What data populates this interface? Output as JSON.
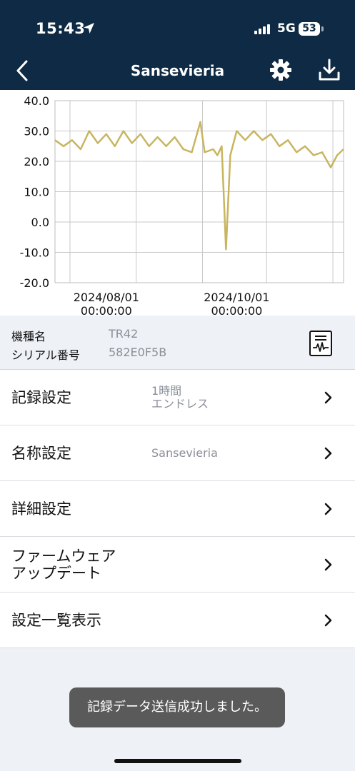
{
  "status": {
    "time": "15:43",
    "network": "5G",
    "battery": "53"
  },
  "nav": {
    "title": "Sansevieria"
  },
  "chart_data": {
    "type": "line",
    "y_ticks": [
      "40.0",
      "30.0",
      "20.0",
      "10.0",
      "0.0",
      "-10.0",
      "-20.0"
    ],
    "ylim": [
      -20,
      40
    ],
    "x_ticks": [
      {
        "date": "2024/08/01",
        "time": "00:00:00"
      },
      {
        "date": "2024/10/01",
        "time": "00:00:00"
      }
    ],
    "x_range": [
      "2024-07-08",
      "2024-11-20"
    ],
    "grid": true,
    "series": [
      {
        "color": "#c8b560",
        "points": [
          [
            "2024-07-08",
            27
          ],
          [
            "2024-07-12",
            25
          ],
          [
            "2024-07-16",
            27
          ],
          [
            "2024-07-20",
            24
          ],
          [
            "2024-07-24",
            30
          ],
          [
            "2024-07-28",
            26
          ],
          [
            "2024-08-01",
            29
          ],
          [
            "2024-08-05",
            25
          ],
          [
            "2024-08-09",
            30
          ],
          [
            "2024-08-13",
            26
          ],
          [
            "2024-08-17",
            29
          ],
          [
            "2024-08-21",
            25
          ],
          [
            "2024-08-25",
            28
          ],
          [
            "2024-08-29",
            25
          ],
          [
            "2024-09-02",
            28
          ],
          [
            "2024-09-06",
            24
          ],
          [
            "2024-09-10",
            23
          ],
          [
            "2024-09-14",
            33
          ],
          [
            "2024-09-16",
            23
          ],
          [
            "2024-09-20",
            24
          ],
          [
            "2024-09-22",
            22
          ],
          [
            "2024-09-24",
            25
          ],
          [
            "2024-09-26",
            -9
          ],
          [
            "2024-09-28",
            22
          ],
          [
            "2024-10-01",
            30
          ],
          [
            "2024-10-05",
            27
          ],
          [
            "2024-10-09",
            30
          ],
          [
            "2024-10-13",
            27
          ],
          [
            "2024-10-17",
            29
          ],
          [
            "2024-10-21",
            25
          ],
          [
            "2024-10-25",
            27
          ],
          [
            "2024-10-29",
            23
          ],
          [
            "2024-11-02",
            25
          ],
          [
            "2024-11-06",
            22
          ],
          [
            "2024-11-10",
            23
          ],
          [
            "2024-11-14",
            18
          ],
          [
            "2024-11-17",
            22
          ],
          [
            "2024-11-20",
            24
          ]
        ]
      }
    ]
  },
  "device": {
    "model_label": "機種名",
    "model_value": "TR42",
    "serial_label": "シリアル番号",
    "serial_value": "582E0F5B"
  },
  "settings": {
    "recording": {
      "label": "記録設定",
      "value_line1": "1時間",
      "value_line2": "エンドレス"
    },
    "name": {
      "label": "名称設定",
      "value": "Sansevieria"
    },
    "detail": {
      "label": "詳細設定"
    },
    "firmware": {
      "label_line1": "ファームウェア",
      "label_line2": "アップデート"
    },
    "list_view": {
      "label": "設定一覧表示"
    }
  },
  "toast": {
    "message": "記録データ送信成功しました。"
  }
}
